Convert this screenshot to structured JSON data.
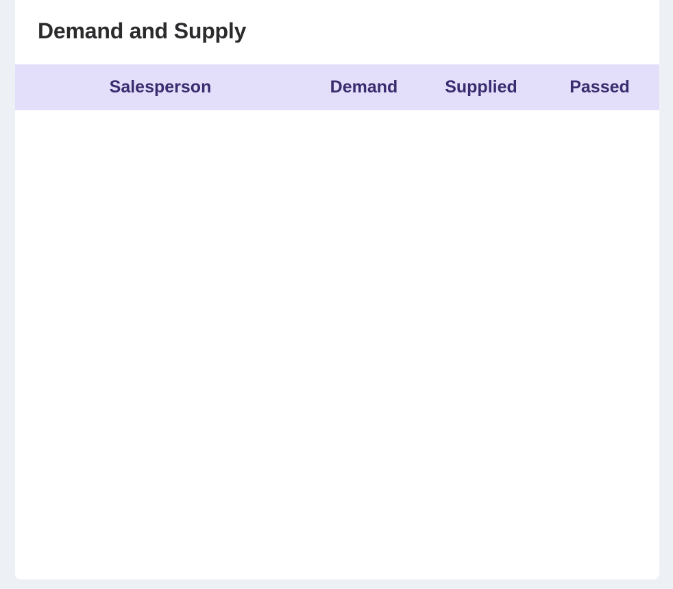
{
  "card": {
    "title": "Demand and Supply"
  },
  "table": {
    "columns": [
      {
        "key": "salesperson",
        "label": "Salesperson"
      },
      {
        "key": "demand",
        "label": "Demand"
      },
      {
        "key": "supplied",
        "label": "Supplied"
      },
      {
        "key": "passed",
        "label": "Passed"
      }
    ],
    "rows": []
  },
  "colors": {
    "page_background": "#edf1f6",
    "card_background": "#ffffff",
    "header_background": "#e3defa",
    "header_text": "#3a2c6e",
    "title_text": "#2b2b2e"
  }
}
